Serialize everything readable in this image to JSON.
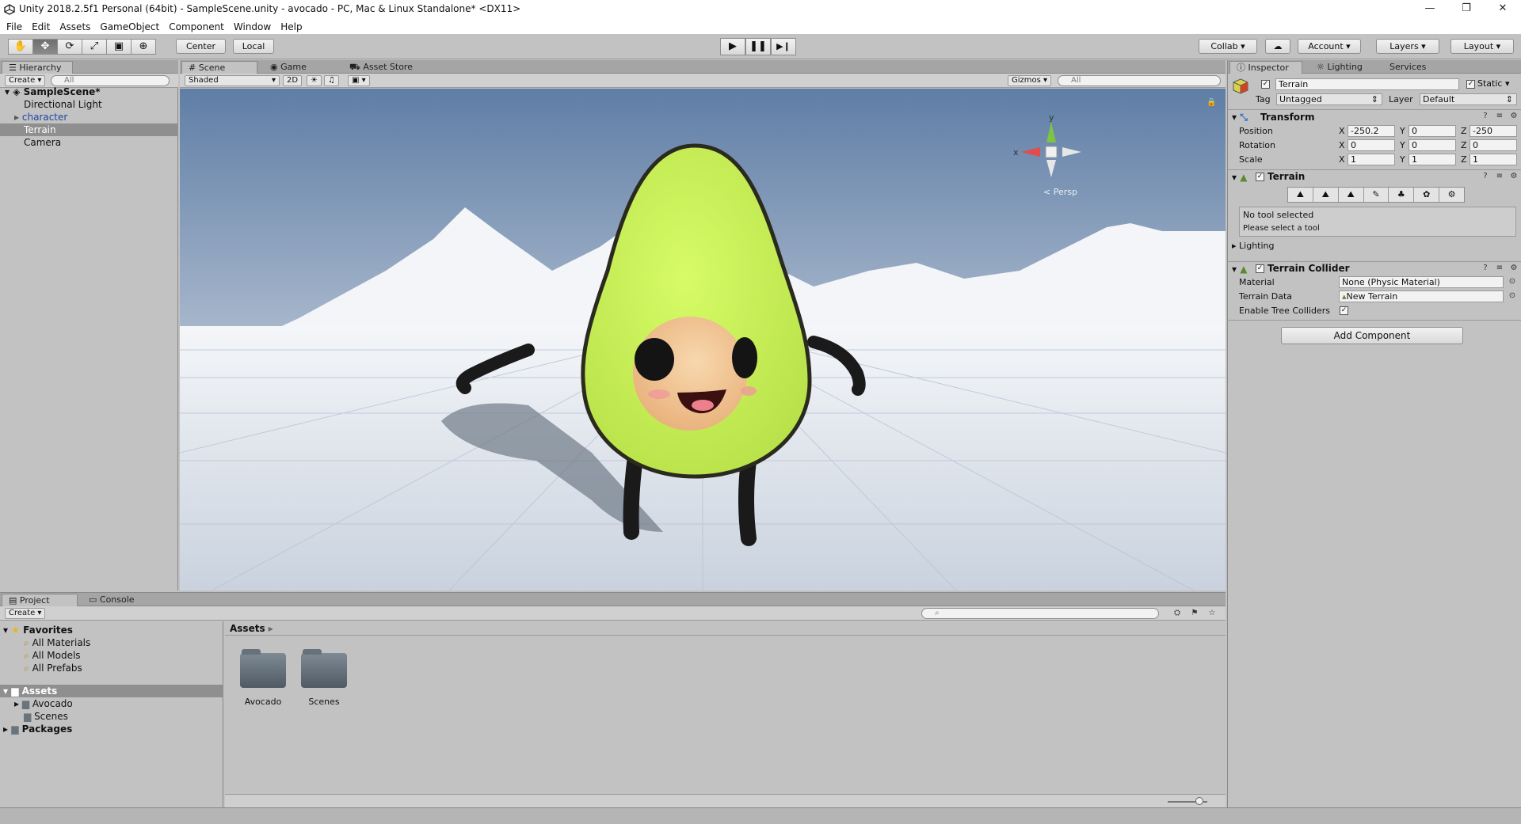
{
  "window": {
    "title": "Unity 2018.2.5f1 Personal (64bit) - SampleScene.unity - avocado - PC, Mac & Linux Standalone* <DX11>",
    "controls": [
      "—",
      "❐",
      "✕"
    ]
  },
  "menu": [
    "File",
    "Edit",
    "Assets",
    "GameObject",
    "Component",
    "Window",
    "Help"
  ],
  "toolbar": {
    "tools": [
      "✋",
      "✥",
      "⟳",
      "⤢",
      "▣",
      "⊕"
    ],
    "pivot": "Center",
    "space": "Local",
    "play": "▶",
    "pause": "❚❚",
    "step": "▶❙",
    "collab": "Collab",
    "account": "Account",
    "layers": "Layers",
    "layout": "Layout"
  },
  "hierarchy": {
    "tab": "Hierarchy",
    "create": "Create",
    "search_placeholder": "All",
    "scene": "SampleScene*",
    "items": [
      "Directional Light",
      "character",
      "Terrain",
      "Camera"
    ]
  },
  "scene_view": {
    "tabs": [
      "Scene",
      "Game",
      "Asset Store"
    ],
    "shading": "Shaded",
    "mode_2d": "2D",
    "gizmos": "Gizmos",
    "search_placeholder": "All",
    "persp": "Persp",
    "gizmo_axes": {
      "y": "y",
      "x": "x"
    }
  },
  "inspector": {
    "tabs": [
      "Inspector",
      "Lighting",
      "Services"
    ],
    "object_name": "Terrain",
    "static": "Static",
    "tag_label": "Tag",
    "tag": "Untagged",
    "layer_label": "Layer",
    "layer": "Default",
    "transform": {
      "title": "Transform",
      "position_label": "Position",
      "rotation_label": "Rotation",
      "scale_label": "Scale",
      "position": {
        "x": "-250.2",
        "y": "0",
        "z": "-250"
      },
      "rotation": {
        "x": "0",
        "y": "0",
        "z": "0"
      },
      "scale": {
        "x": "1",
        "y": "1",
        "z": "1"
      },
      "axis_x": "X",
      "axis_y": "Y",
      "axis_z": "Z"
    },
    "terrain": {
      "title": "Terrain",
      "no_tool": "No tool selected",
      "select_tool": "Please select a tool",
      "lighting": "Lighting"
    },
    "terrain_collider": {
      "title": "Terrain Collider",
      "material_label": "Material",
      "material": "None (Physic Material)",
      "data_label": "Terrain Data",
      "data": "New Terrain",
      "tree_label": "Enable Tree Colliders"
    },
    "add_component": "Add Component"
  },
  "project": {
    "tabs": [
      "Project",
      "Console"
    ],
    "create": "Create",
    "favorites": "Favorites",
    "favorite_items": [
      "All Materials",
      "All Models",
      "All Prefabs"
    ],
    "assets_root": "Assets",
    "asset_folders": [
      "Avocado",
      "Scenes"
    ],
    "packages": "Packages",
    "breadcrumb": "Assets",
    "grid_items": [
      "Avocado",
      "Scenes"
    ]
  },
  "colors": {
    "avocado_skin": "#cdf55e",
    "avocado_outline": "#2a2a1e",
    "seed": "#f2c79a",
    "sky_top": "#5f7ea6",
    "selection": "#8f8f8f"
  }
}
